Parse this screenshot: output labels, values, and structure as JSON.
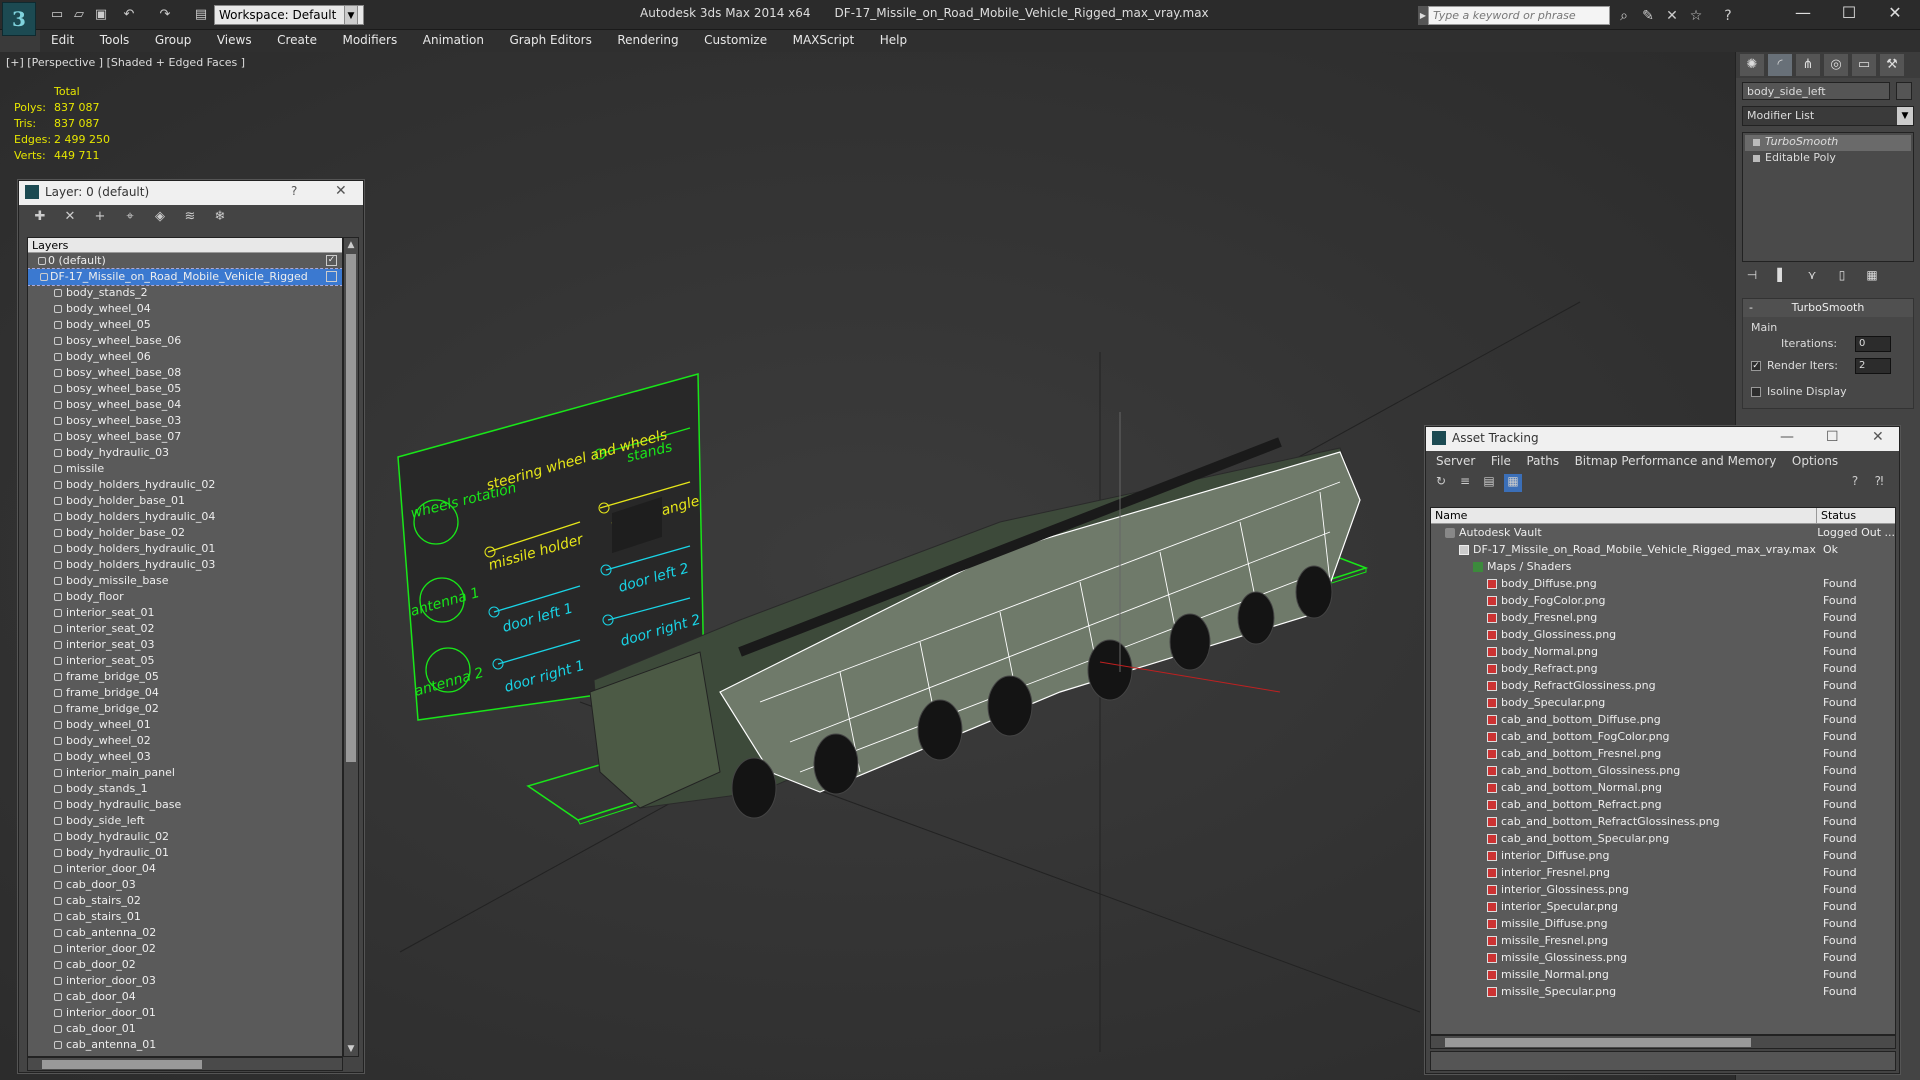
{
  "titlebar": {
    "workspace": "Workspace: Default",
    "app": "Autodesk 3ds Max  2014 x64",
    "file": "DF-17_Missile_on_Road_Mobile_Vehicle_Rigged_max_vray.max",
    "search_placeholder": "Type a keyword or phrase"
  },
  "menu": [
    "Edit",
    "Tools",
    "Group",
    "Views",
    "Create",
    "Modifiers",
    "Animation",
    "Graph Editors",
    "Rendering",
    "Customize",
    "MAXScript",
    "Help"
  ],
  "viewport": {
    "label": "[+] [Perspective ] [Shaded + Edged Faces ]",
    "stats": {
      "header": "Total",
      "rows": [
        {
          "k": "Polys:",
          "v": "837 087"
        },
        {
          "k": "Tris:",
          "v": "837 087"
        },
        {
          "k": "Edges:",
          "v": "2 499 250"
        },
        {
          "k": "Verts:",
          "v": "449 711"
        }
      ]
    },
    "rig_labels": [
      "wheels rotation",
      "steering wheel and wheels",
      "stands",
      "missile holder",
      "missile angle",
      "antenna 1",
      "door left 1",
      "door left 2",
      "antenna 2",
      "door right 1",
      "door right 2"
    ]
  },
  "command_panel": {
    "object_name": "body_side_left",
    "modifier_list": "Modifier List",
    "stack": [
      {
        "label": "TurboSmooth",
        "selected": true
      },
      {
        "label": "Editable Poly",
        "selected": false
      }
    ],
    "rollout": {
      "title": "TurboSmooth",
      "group": "Main",
      "iterations_label": "Iterations:",
      "iterations": "0",
      "render_iters_label": "Render Iters:",
      "render_iters": "2",
      "isoline": "Isoline Display"
    }
  },
  "layer_panel": {
    "title": "Layer: 0 (default)",
    "column": "Layers",
    "items": [
      {
        "label": "0 (default)",
        "level": 0,
        "check": true
      },
      {
        "label": "DF-17_Missile_on_Road_Mobile_Vehicle_Rigged",
        "level": 1,
        "selected": true
      },
      {
        "label": "body_stands_2"
      },
      {
        "label": "body_wheel_04"
      },
      {
        "label": "body_wheel_05"
      },
      {
        "label": "bosy_wheel_base_06"
      },
      {
        "label": "body_wheel_06"
      },
      {
        "label": "bosy_wheel_base_08"
      },
      {
        "label": "bosy_wheel_base_05"
      },
      {
        "label": "bosy_wheel_base_04"
      },
      {
        "label": "bosy_wheel_base_03"
      },
      {
        "label": "bosy_wheel_base_07"
      },
      {
        "label": "body_hydraulic_03"
      },
      {
        "label": "missile"
      },
      {
        "label": "body_holders_hydraulic_02"
      },
      {
        "label": "body_holder_base_01"
      },
      {
        "label": "body_holders_hydraulic_04"
      },
      {
        "label": "body_holder_base_02"
      },
      {
        "label": "body_holders_hydraulic_01"
      },
      {
        "label": "body_holders_hydraulic_03"
      },
      {
        "label": "body_missile_base"
      },
      {
        "label": "body_floor"
      },
      {
        "label": "interior_seat_01"
      },
      {
        "label": "interior_seat_02"
      },
      {
        "label": "interior_seat_03"
      },
      {
        "label": "interior_seat_05"
      },
      {
        "label": "frame_bridge_05"
      },
      {
        "label": "frame_bridge_04"
      },
      {
        "label": "frame_bridge_02"
      },
      {
        "label": "body_wheel_01"
      },
      {
        "label": "body_wheel_02"
      },
      {
        "label": "body_wheel_03"
      },
      {
        "label": "interior_main_panel"
      },
      {
        "label": "body_stands_1"
      },
      {
        "label": "body_hydraulic_base"
      },
      {
        "label": "body_side_left"
      },
      {
        "label": "body_hydraulic_02"
      },
      {
        "label": "body_hydraulic_01"
      },
      {
        "label": "interior_door_04"
      },
      {
        "label": "cab_door_03"
      },
      {
        "label": "cab_stairs_02"
      },
      {
        "label": "cab_stairs_01"
      },
      {
        "label": "cab_antenna_02"
      },
      {
        "label": "interior_door_02"
      },
      {
        "label": "cab_door_02"
      },
      {
        "label": "interior_door_03"
      },
      {
        "label": "cab_door_04"
      },
      {
        "label": "interior_door_01"
      },
      {
        "label": "cab_door_01"
      },
      {
        "label": "cab_antenna_01"
      }
    ]
  },
  "asset_panel": {
    "title": "Asset Tracking",
    "menu": [
      "Server",
      "File",
      "Paths",
      "Bitmap Performance and Memory",
      "Options"
    ],
    "col_name": "Name",
    "col_status": "Status",
    "rows": [
      {
        "name": "Autodesk Vault",
        "status": "Logged Out ...",
        "indent": 1,
        "icon": "vault"
      },
      {
        "name": "DF-17_Missile_on_Road_Mobile_Vehicle_Rigged_max_vray.max",
        "status": "Ok",
        "indent": 2,
        "icon": "file"
      },
      {
        "name": "Maps / Shaders",
        "status": "",
        "indent": 3,
        "icon": "fold"
      },
      {
        "name": "body_Diffuse.png",
        "status": "Found",
        "indent": 4,
        "icon": "png"
      },
      {
        "name": "body_FogColor.png",
        "status": "Found",
        "indent": 4,
        "icon": "png"
      },
      {
        "name": "body_Fresnel.png",
        "status": "Found",
        "indent": 4,
        "icon": "png"
      },
      {
        "name": "body_Glossiness.png",
        "status": "Found",
        "indent": 4,
        "icon": "png"
      },
      {
        "name": "body_Normal.png",
        "status": "Found",
        "indent": 4,
        "icon": "png"
      },
      {
        "name": "body_Refract.png",
        "status": "Found",
        "indent": 4,
        "icon": "png"
      },
      {
        "name": "body_RefractGlossiness.png",
        "status": "Found",
        "indent": 4,
        "icon": "png"
      },
      {
        "name": "body_Specular.png",
        "status": "Found",
        "indent": 4,
        "icon": "png"
      },
      {
        "name": "cab_and_bottom_Diffuse.png",
        "status": "Found",
        "indent": 4,
        "icon": "png"
      },
      {
        "name": "cab_and_bottom_FogColor.png",
        "status": "Found",
        "indent": 4,
        "icon": "png"
      },
      {
        "name": "cab_and_bottom_Fresnel.png",
        "status": "Found",
        "indent": 4,
        "icon": "png"
      },
      {
        "name": "cab_and_bottom_Glossiness.png",
        "status": "Found",
        "indent": 4,
        "icon": "png"
      },
      {
        "name": "cab_and_bottom_Normal.png",
        "status": "Found",
        "indent": 4,
        "icon": "png"
      },
      {
        "name": "cab_and_bottom_Refract.png",
        "status": "Found",
        "indent": 4,
        "icon": "png"
      },
      {
        "name": "cab_and_bottom_RefractGlossiness.png",
        "status": "Found",
        "indent": 4,
        "icon": "png"
      },
      {
        "name": "cab_and_bottom_Specular.png",
        "status": "Found",
        "indent": 4,
        "icon": "png"
      },
      {
        "name": "interior_Diffuse.png",
        "status": "Found",
        "indent": 4,
        "icon": "png"
      },
      {
        "name": "interior_Fresnel.png",
        "status": "Found",
        "indent": 4,
        "icon": "png"
      },
      {
        "name": "interior_Glossiness.png",
        "status": "Found",
        "indent": 4,
        "icon": "png"
      },
      {
        "name": "interior_Specular.png",
        "status": "Found",
        "indent": 4,
        "icon": "png"
      },
      {
        "name": "missile_Diffuse.png",
        "status": "Found",
        "indent": 4,
        "icon": "png"
      },
      {
        "name": "missile_Fresnel.png",
        "status": "Found",
        "indent": 4,
        "icon": "png"
      },
      {
        "name": "missile_Glossiness.png",
        "status": "Found",
        "indent": 4,
        "icon": "png"
      },
      {
        "name": "missile_Normal.png",
        "status": "Found",
        "indent": 4,
        "icon": "png"
      },
      {
        "name": "missile_Specular.png",
        "status": "Found",
        "indent": 4,
        "icon": "png"
      }
    ]
  },
  "colors": {
    "rig_green": "#19e619",
    "rig_yellow": "#e6e619",
    "rig_cyan": "#19d4e6",
    "stats_yellow": "#e6e600",
    "selection_blue": "#3b79d0"
  }
}
